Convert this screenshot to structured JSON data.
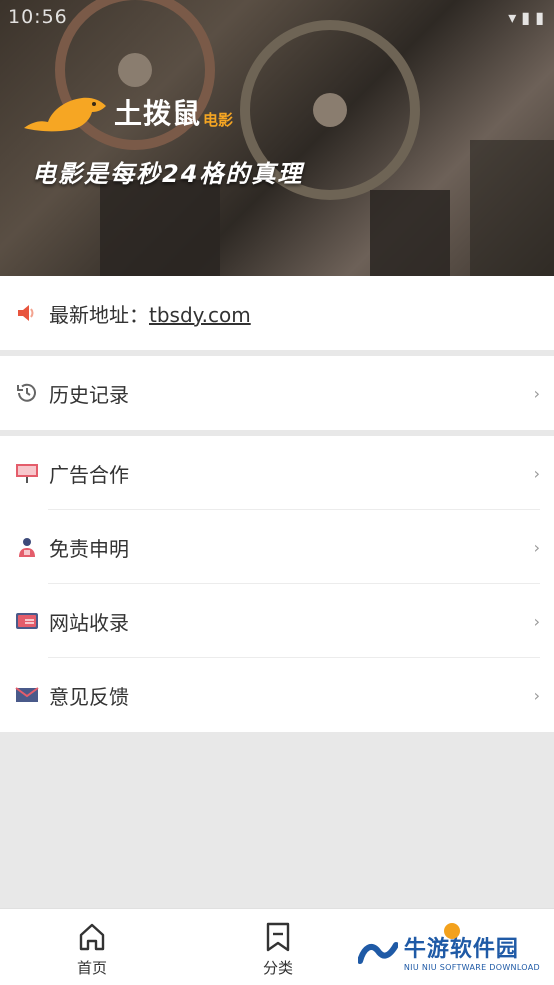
{
  "status_bar": {
    "time": "10:56"
  },
  "banner": {
    "brand_name": "土拨鼠",
    "brand_sub": "电影",
    "slogan": "电影是每秒24格的真理"
  },
  "address": {
    "prefix": "最新地址：",
    "link": "tbsdy.com"
  },
  "history": {
    "label": "历史记录"
  },
  "menu": [
    {
      "label": "广告合作",
      "icon": "billboard-icon"
    },
    {
      "label": "免责申明",
      "icon": "person-icon"
    },
    {
      "label": "网站收录",
      "icon": "folder-icon"
    },
    {
      "label": "意见反馈",
      "icon": "mail-icon"
    }
  ],
  "tabbar": {
    "home": "首页",
    "category": "分类"
  },
  "watermark": {
    "cn": "牛游软件园",
    "en": "NIU NIU SOFTWARE DOWNLOAD"
  },
  "colors": {
    "accent_orange": "#f6a623",
    "watermark_blue": "#1f5aa6",
    "speaker_red": "#e8553e"
  }
}
